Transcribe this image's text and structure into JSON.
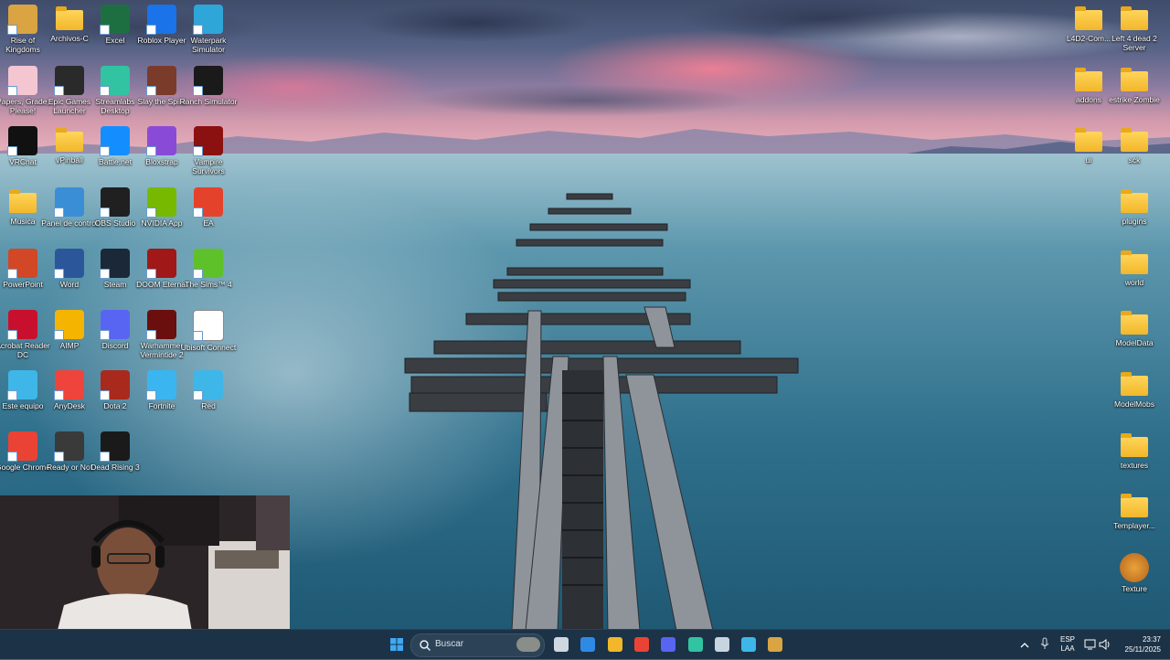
{
  "desktop": {
    "left_icons": [
      {
        "label": "Rise of Kingdoms",
        "icon": "rise-of-kingdoms-icon",
        "color": "#d9a441"
      },
      {
        "label": "Archivos-C",
        "icon": "folder-icon",
        "color": "#f2b72a"
      },
      {
        "label": "Excel",
        "icon": "excel-icon",
        "color": "#1d6f42"
      },
      {
        "label": "Roblox Player",
        "icon": "roblox-icon",
        "color": "#1a73e8"
      },
      {
        "label": "Waterpark Simulator",
        "icon": "waterpark-simulator-icon",
        "color": "#2fa6d8"
      },
      {
        "label": "Papers, Grade, Please!",
        "icon": "papers-grade-please-icon",
        "color": "#f3c6d2"
      },
      {
        "label": "Epic Games Launcher",
        "icon": "epic-games-icon",
        "color": "#2a2a2a"
      },
      {
        "label": "Streamlabs Desktop",
        "icon": "streamlabs-icon",
        "color": "#31c3a2"
      },
      {
        "label": "Slay the Spire",
        "icon": "slay-the-spire-icon",
        "color": "#7a3b2b"
      },
      {
        "label": "Ranch Simulator",
        "icon": "ranch-simulator-icon",
        "color": "#1a1a1a"
      },
      {
        "label": "VRChat",
        "icon": "vrchat-icon",
        "color": "#111111"
      },
      {
        "label": "vPinball",
        "icon": "folder-icon",
        "color": "#f2b72a"
      },
      {
        "label": "Battle.net",
        "icon": "battlenet-icon",
        "color": "#148eff"
      },
      {
        "label": "Bloxstrap",
        "icon": "bloxstrap-icon",
        "color": "#8a4ad8"
      },
      {
        "label": "Vampire Survivors",
        "icon": "vampire-survivors-icon",
        "color": "#8b1010"
      },
      {
        "label": "Musica",
        "icon": "folder-icon",
        "color": "#f2b72a"
      },
      {
        "label": "Panel de control",
        "icon": "control-panel-icon",
        "color": "#3a8ed6"
      },
      {
        "label": "OBS Studio",
        "icon": "obs-studio-icon",
        "color": "#202020"
      },
      {
        "label": "NVIDIA App",
        "icon": "nvidia-icon",
        "color": "#76b900"
      },
      {
        "label": "EA",
        "icon": "ea-icon",
        "color": "#e5422b"
      },
      {
        "label": "PowerPoint",
        "icon": "powerpoint-icon",
        "color": "#d24726"
      },
      {
        "label": "Word",
        "icon": "word-icon",
        "color": "#2b579a"
      },
      {
        "label": "Steam",
        "icon": "steam-icon",
        "color": "#1b2838"
      },
      {
        "label": "DOOM Eternal",
        "icon": "doom-eternal-icon",
        "color": "#a01818"
      },
      {
        "label": "The Sims™ 4",
        "icon": "the-sims-4-icon",
        "color": "#5fc12a"
      },
      {
        "label": "Acrobat Reader DC",
        "icon": "acrobat-icon",
        "color": "#c8102e"
      },
      {
        "label": "AIMP",
        "icon": "aimp-icon",
        "color": "#f4b400"
      },
      {
        "label": "Discord",
        "icon": "discord-icon",
        "color": "#5865f2"
      },
      {
        "label": "Warhammer Vermintide 2",
        "icon": "vermintide-icon",
        "color": "#6a0e0e"
      },
      {
        "label": "Ubisoft Connect",
        "icon": "ubisoft-connect-icon",
        "color": "#ffffff"
      },
      {
        "label": "Este equipo",
        "icon": "this-pc-icon",
        "color": "#3fb6e8"
      },
      {
        "label": "AnyDesk",
        "icon": "anydesk-icon",
        "color": "#ef443b"
      },
      {
        "label": "Dota 2",
        "icon": "dota-2-icon",
        "color": "#a92a1c"
      },
      {
        "label": "Fortnite",
        "icon": "fortnite-icon",
        "color": "#3ab5f0"
      },
      {
        "label": "Red",
        "icon": "network-icon",
        "color": "#3fb6e8"
      },
      {
        "label": "Google Chrome",
        "icon": "chrome-icon",
        "color": "#ea4335"
      },
      {
        "label": "Ready or Not",
        "icon": "ready-or-not-icon",
        "color": "#3a3a3a"
      },
      {
        "label": "Dead Rising 3",
        "icon": "dead-rising-3-icon",
        "color": "#1a1a1a"
      }
    ],
    "right_icons": [
      {
        "label": "L4D2-Com...",
        "icon": "folder-icon"
      },
      {
        "label": "Left 4 dead 2 Server",
        "icon": "folder-icon"
      },
      {
        "label": "addons",
        "icon": "folder-icon"
      },
      {
        "label": "estrike Zombie",
        "icon": "folder-icon"
      },
      {
        "label": "ui",
        "icon": "folder-icon"
      },
      {
        "label": "sck",
        "icon": "folder-icon"
      },
      {
        "label": "plugins",
        "icon": "folder-icon"
      },
      {
        "label": "world",
        "icon": "folder-icon"
      },
      {
        "label": "ModelData",
        "icon": "folder-icon"
      },
      {
        "label": "ModelMobs",
        "icon": "folder-icon"
      },
      {
        "label": "textures",
        "icon": "folder-icon"
      },
      {
        "label": "Templayer...",
        "icon": "folder-icon"
      },
      {
        "label": "Texture",
        "icon": "texture-app-icon"
      }
    ]
  },
  "taskbar": {
    "start_icon": "windows-start-icon",
    "search_placeholder": "Buscar",
    "pinned": [
      {
        "name": "task-view-icon",
        "color": "#cfd8e0"
      },
      {
        "name": "microsoft-store-icon",
        "color": "#2f8ae6"
      },
      {
        "name": "file-explorer-icon",
        "color": "#f2b72a"
      },
      {
        "name": "chrome-icon",
        "color": "#ea4335"
      },
      {
        "name": "discord-icon",
        "color": "#5865f2"
      },
      {
        "name": "streamlabs-icon",
        "color": "#31c3a2"
      },
      {
        "name": "steam-icon",
        "color": "#c7d5e0"
      },
      {
        "name": "photos-icon",
        "color": "#3fb6e8"
      },
      {
        "name": "game-icon",
        "color": "#d9a441"
      }
    ],
    "language_line1": "ESP",
    "language_line2": "LAA",
    "time": "23:37",
    "date": "25/11/2025"
  }
}
